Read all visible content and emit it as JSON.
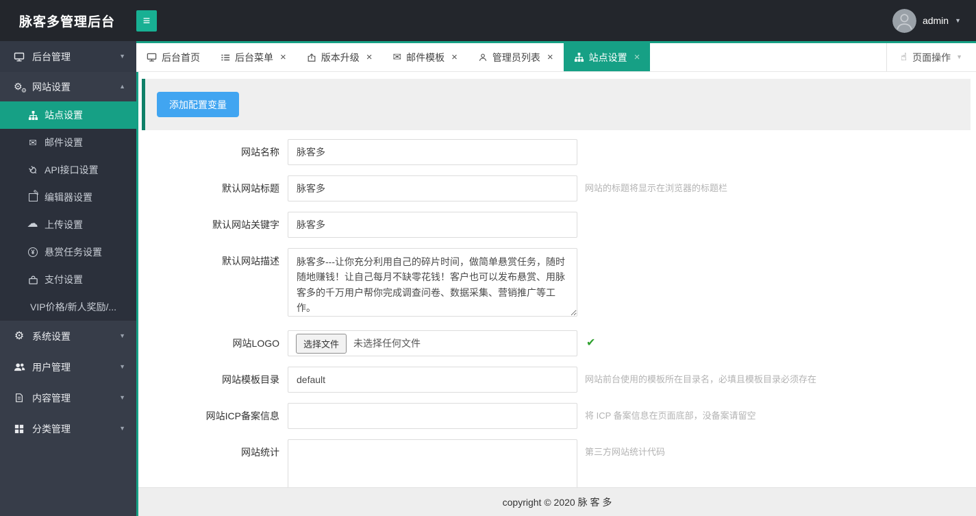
{
  "header": {
    "brand": "脉客多管理后台",
    "username": "admin"
  },
  "icons": {
    "hamburger": "≡",
    "caret_down": "▼",
    "caret_up": "▲",
    "close": "×",
    "check": "✔",
    "envelope": "✉",
    "gear": "⚙",
    "cloud": "☁",
    "up_arrow": "↑",
    "pencil": "✎",
    "yen": "¥",
    "hand": "☝"
  },
  "sidebar": {
    "items": [
      {
        "label": "后台管理"
      },
      {
        "label": "网站设置"
      }
    ],
    "submenu": [
      "站点设置",
      "邮件设置",
      "API接口设置",
      "编辑器设置",
      "上传设置",
      "悬赏任务设置",
      "支付设置",
      "VIP价格/新人奖励/..."
    ],
    "bottom": [
      "系统设置",
      "用户管理",
      "内容管理",
      "分类管理"
    ]
  },
  "tabbar": {
    "tabs": [
      "后台首页",
      "后台菜单",
      "版本升级",
      "邮件模板",
      "管理员列表",
      "站点设置"
    ],
    "page_actions": "页面操作"
  },
  "content": {
    "add_button": "添加配置变量",
    "form": {
      "rows": [
        {
          "label": "网站名称",
          "value": "脉客多",
          "hint": ""
        },
        {
          "label": "默认网站标题",
          "value": "脉客多",
          "hint": "网站的标题将显示在浏览器的标题栏"
        },
        {
          "label": "默认网站关键字",
          "value": "脉客多",
          "hint": ""
        },
        {
          "label": "默认网站描述",
          "value": "脉客多---让你充分利用自己的碎片时间，做简单悬赏任务，随时随地赚钱！让自己每月不缺零花钱！客户也可以发布悬赏、用脉客多的千万用户帮你完成调查问卷、数据采集、营销推广等工作。",
          "hint": ""
        },
        {
          "label": "网站LOGO",
          "button_label": "选择文件",
          "status": "未选择任何文件",
          "hint": ""
        },
        {
          "label": "网站模板目录",
          "value": "default",
          "hint": "网站前台使用的模板所在目录名，必填且模板目录必须存在"
        },
        {
          "label": "网站ICP备案信息",
          "value": "",
          "hint": "将 ICP 备案信息在页面底部，没备案请留空"
        },
        {
          "label": "网站统计",
          "value": "",
          "hint": "第三方网站统计代码"
        }
      ]
    },
    "footer": "copyright © 2020 脉 客 多"
  },
  "colors": {
    "accent": "#16a085",
    "button_blue": "#41a5f1",
    "check_green": "#2fa12f"
  }
}
